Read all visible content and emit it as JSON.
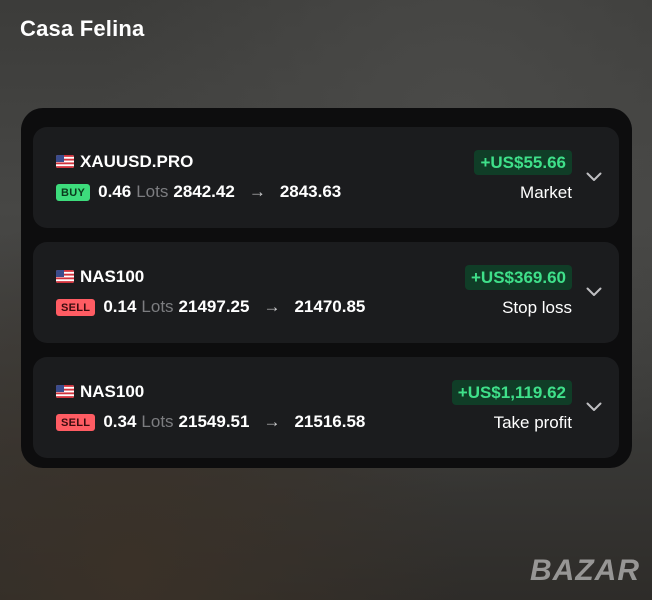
{
  "app": {
    "title": "Casa Felina"
  },
  "colors": {
    "profit_text": "#3fe08a",
    "profit_bg": "#103d27",
    "buy_badge": "#3ddc7c",
    "sell_badge": "#ff5c63"
  },
  "trades": [
    {
      "flag_icon": "us-flag-icon",
      "symbol": "XAUUSD.PRO",
      "side": "BUY",
      "volume": "0.46",
      "lots_label": "Lots",
      "open_price": "2842.42",
      "arrow": "→",
      "close_price": "2843.63",
      "profit": "+US$55.66",
      "close_reason": "Market"
    },
    {
      "flag_icon": "us-flag-icon",
      "symbol": "NAS100",
      "side": "SELL",
      "volume": "0.14",
      "lots_label": "Lots",
      "open_price": "21497.25",
      "arrow": "→",
      "close_price": "21470.85",
      "profit": "+US$369.60",
      "close_reason": "Stop loss"
    },
    {
      "flag_icon": "us-flag-icon",
      "symbol": "NAS100",
      "side": "SELL",
      "volume": "0.34",
      "lots_label": "Lots",
      "open_price": "21549.51",
      "arrow": "→",
      "close_price": "21516.58",
      "profit": "+US$1,119.62",
      "close_reason": "Take profit"
    }
  ],
  "watermark": {
    "text": "BAZAR"
  }
}
